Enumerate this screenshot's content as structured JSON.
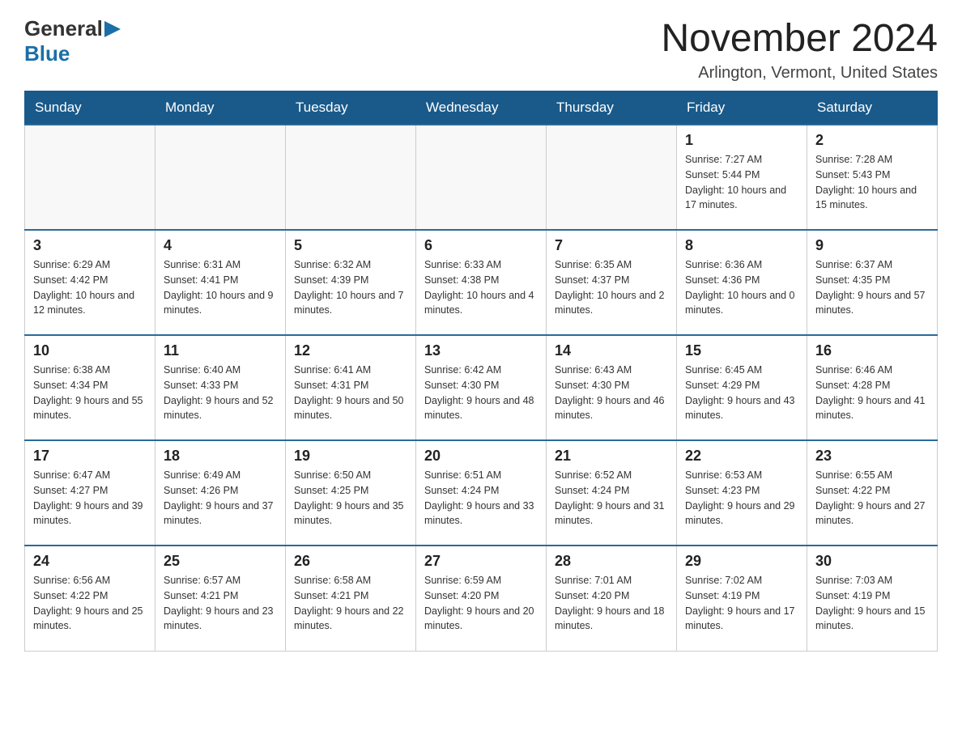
{
  "header": {
    "logo_line1": "General",
    "logo_line2": "Blue",
    "month_title": "November 2024",
    "location": "Arlington, Vermont, United States"
  },
  "days_of_week": [
    "Sunday",
    "Monday",
    "Tuesday",
    "Wednesday",
    "Thursday",
    "Friday",
    "Saturday"
  ],
  "weeks": [
    [
      {
        "day": "",
        "sunrise": "",
        "sunset": "",
        "daylight": ""
      },
      {
        "day": "",
        "sunrise": "",
        "sunset": "",
        "daylight": ""
      },
      {
        "day": "",
        "sunrise": "",
        "sunset": "",
        "daylight": ""
      },
      {
        "day": "",
        "sunrise": "",
        "sunset": "",
        "daylight": ""
      },
      {
        "day": "",
        "sunrise": "",
        "sunset": "",
        "daylight": ""
      },
      {
        "day": "1",
        "sunrise": "Sunrise: 7:27 AM",
        "sunset": "Sunset: 5:44 PM",
        "daylight": "Daylight: 10 hours and 17 minutes."
      },
      {
        "day": "2",
        "sunrise": "Sunrise: 7:28 AM",
        "sunset": "Sunset: 5:43 PM",
        "daylight": "Daylight: 10 hours and 15 minutes."
      }
    ],
    [
      {
        "day": "3",
        "sunrise": "Sunrise: 6:29 AM",
        "sunset": "Sunset: 4:42 PM",
        "daylight": "Daylight: 10 hours and 12 minutes."
      },
      {
        "day": "4",
        "sunrise": "Sunrise: 6:31 AM",
        "sunset": "Sunset: 4:41 PM",
        "daylight": "Daylight: 10 hours and 9 minutes."
      },
      {
        "day": "5",
        "sunrise": "Sunrise: 6:32 AM",
        "sunset": "Sunset: 4:39 PM",
        "daylight": "Daylight: 10 hours and 7 minutes."
      },
      {
        "day": "6",
        "sunrise": "Sunrise: 6:33 AM",
        "sunset": "Sunset: 4:38 PM",
        "daylight": "Daylight: 10 hours and 4 minutes."
      },
      {
        "day": "7",
        "sunrise": "Sunrise: 6:35 AM",
        "sunset": "Sunset: 4:37 PM",
        "daylight": "Daylight: 10 hours and 2 minutes."
      },
      {
        "day": "8",
        "sunrise": "Sunrise: 6:36 AM",
        "sunset": "Sunset: 4:36 PM",
        "daylight": "Daylight: 10 hours and 0 minutes."
      },
      {
        "day": "9",
        "sunrise": "Sunrise: 6:37 AM",
        "sunset": "Sunset: 4:35 PM",
        "daylight": "Daylight: 9 hours and 57 minutes."
      }
    ],
    [
      {
        "day": "10",
        "sunrise": "Sunrise: 6:38 AM",
        "sunset": "Sunset: 4:34 PM",
        "daylight": "Daylight: 9 hours and 55 minutes."
      },
      {
        "day": "11",
        "sunrise": "Sunrise: 6:40 AM",
        "sunset": "Sunset: 4:33 PM",
        "daylight": "Daylight: 9 hours and 52 minutes."
      },
      {
        "day": "12",
        "sunrise": "Sunrise: 6:41 AM",
        "sunset": "Sunset: 4:31 PM",
        "daylight": "Daylight: 9 hours and 50 minutes."
      },
      {
        "day": "13",
        "sunrise": "Sunrise: 6:42 AM",
        "sunset": "Sunset: 4:30 PM",
        "daylight": "Daylight: 9 hours and 48 minutes."
      },
      {
        "day": "14",
        "sunrise": "Sunrise: 6:43 AM",
        "sunset": "Sunset: 4:30 PM",
        "daylight": "Daylight: 9 hours and 46 minutes."
      },
      {
        "day": "15",
        "sunrise": "Sunrise: 6:45 AM",
        "sunset": "Sunset: 4:29 PM",
        "daylight": "Daylight: 9 hours and 43 minutes."
      },
      {
        "day": "16",
        "sunrise": "Sunrise: 6:46 AM",
        "sunset": "Sunset: 4:28 PM",
        "daylight": "Daylight: 9 hours and 41 minutes."
      }
    ],
    [
      {
        "day": "17",
        "sunrise": "Sunrise: 6:47 AM",
        "sunset": "Sunset: 4:27 PM",
        "daylight": "Daylight: 9 hours and 39 minutes."
      },
      {
        "day": "18",
        "sunrise": "Sunrise: 6:49 AM",
        "sunset": "Sunset: 4:26 PM",
        "daylight": "Daylight: 9 hours and 37 minutes."
      },
      {
        "day": "19",
        "sunrise": "Sunrise: 6:50 AM",
        "sunset": "Sunset: 4:25 PM",
        "daylight": "Daylight: 9 hours and 35 minutes."
      },
      {
        "day": "20",
        "sunrise": "Sunrise: 6:51 AM",
        "sunset": "Sunset: 4:24 PM",
        "daylight": "Daylight: 9 hours and 33 minutes."
      },
      {
        "day": "21",
        "sunrise": "Sunrise: 6:52 AM",
        "sunset": "Sunset: 4:24 PM",
        "daylight": "Daylight: 9 hours and 31 minutes."
      },
      {
        "day": "22",
        "sunrise": "Sunrise: 6:53 AM",
        "sunset": "Sunset: 4:23 PM",
        "daylight": "Daylight: 9 hours and 29 minutes."
      },
      {
        "day": "23",
        "sunrise": "Sunrise: 6:55 AM",
        "sunset": "Sunset: 4:22 PM",
        "daylight": "Daylight: 9 hours and 27 minutes."
      }
    ],
    [
      {
        "day": "24",
        "sunrise": "Sunrise: 6:56 AM",
        "sunset": "Sunset: 4:22 PM",
        "daylight": "Daylight: 9 hours and 25 minutes."
      },
      {
        "day": "25",
        "sunrise": "Sunrise: 6:57 AM",
        "sunset": "Sunset: 4:21 PM",
        "daylight": "Daylight: 9 hours and 23 minutes."
      },
      {
        "day": "26",
        "sunrise": "Sunrise: 6:58 AM",
        "sunset": "Sunset: 4:21 PM",
        "daylight": "Daylight: 9 hours and 22 minutes."
      },
      {
        "day": "27",
        "sunrise": "Sunrise: 6:59 AM",
        "sunset": "Sunset: 4:20 PM",
        "daylight": "Daylight: 9 hours and 20 minutes."
      },
      {
        "day": "28",
        "sunrise": "Sunrise: 7:01 AM",
        "sunset": "Sunset: 4:20 PM",
        "daylight": "Daylight: 9 hours and 18 minutes."
      },
      {
        "day": "29",
        "sunrise": "Sunrise: 7:02 AM",
        "sunset": "Sunset: 4:19 PM",
        "daylight": "Daylight: 9 hours and 17 minutes."
      },
      {
        "day": "30",
        "sunrise": "Sunrise: 7:03 AM",
        "sunset": "Sunset: 4:19 PM",
        "daylight": "Daylight: 9 hours and 15 minutes."
      }
    ]
  ]
}
